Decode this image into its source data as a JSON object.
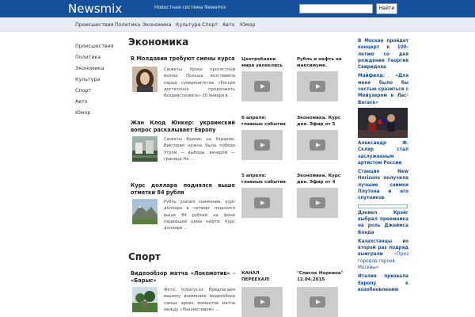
{
  "header": {
    "logo": "Newsmix",
    "tagline": "Новостная система Newsmix",
    "search_placeholder": "",
    "search_button": "Найти",
    "bg_color": "#15519a"
  },
  "nav": {
    "items": [
      "Происшествия",
      "Политика",
      "Экономика",
      "Культура",
      "Спорт",
      "Авто",
      "Юмор"
    ]
  },
  "sidebar": {
    "items": [
      "Происшествия",
      "Политика",
      "Экономика",
      "Культура",
      "Спорт",
      "Авто",
      "Юмор"
    ]
  },
  "economy": {
    "title": "Экономика",
    "articles": [
      {
        "title": "В Молдавии требуют смены курса",
        "excerpt": "Сюжеты Уроки протестной волны: Польша возглавила парад суверенитетов «Россия достаточно продолжать бездействовать» 20 января в ..."
      },
      {
        "title": "Жан Клод Юнкер: украинский вопрос раскалывает Европу",
        "excerpt": "Сюжеты Кризис на Украине: Виктория нужна была победа Утром — выборы, вечером — граница На ..."
      },
      {
        "title": "Курс доллара поднялся выше отметки 84 рубля",
        "excerpt": "Рубль усилил снижение, курс доллара в четверг поднялся выше 84 рублей на фоне падающей цены нефти. Курс доллара ..."
      }
    ],
    "videos": [
      {
        "title": "Центробанки мира увлеклись"
      },
      {
        "title": "Рубль и нефть на максимуме."
      },
      {
        "title": "6 апреля: главные события"
      },
      {
        "title": "Экономика. Курс дня. Эфир от 5"
      },
      {
        "title": "5 апреля: главные события"
      },
      {
        "title": "Экономика. Курс дня. Эфир от 4"
      }
    ]
  },
  "sport": {
    "title": "Спорт",
    "articles": [
      {
        "title": "Видеообзор матча «Локомотив» - «Барыс»",
        "excerpt": "Фото: hcbarys.kz Предлагаем вашему вниманию видеообзор самых ярких моментов матча между «Локомотивом» ..."
      }
    ],
    "videos": [
      {
        "title": "КАНАЛ ПЕРЕЕХАЛ!"
      },
      {
        "title": "\"Список Норкина\" 12.04.2015"
      }
    ]
  },
  "right_sidebar": {
    "items": [
      {
        "link": "В Москве пройдет концерт к 100-летию со дня рождения Георгия Свиридова",
        "plain": ""
      },
      {
        "link": "Майфилд: «Для меня было бы честью сразиться с Мейузером в Лас-Вегасе»",
        "plain": ""
      },
      {
        "link": "Александр Ф. Скляр стал заслуженным артистом России",
        "plain": ""
      },
      {
        "link": "Станция New Horizons получила лучшие снимки Плутона и его спутников",
        "plain": ""
      },
      {
        "link": "Дэниел Крэйг выбрал преемника на роль Джеймса Бонда",
        "plain": ""
      },
      {
        "link": "Казахстанцы во второй раз подряд выиграли",
        "plain": "«Приз городов-героев Москвы»"
      },
      {
        "link": "Италия призвала Европу к возобновлению",
        "plain": ""
      }
    ]
  }
}
